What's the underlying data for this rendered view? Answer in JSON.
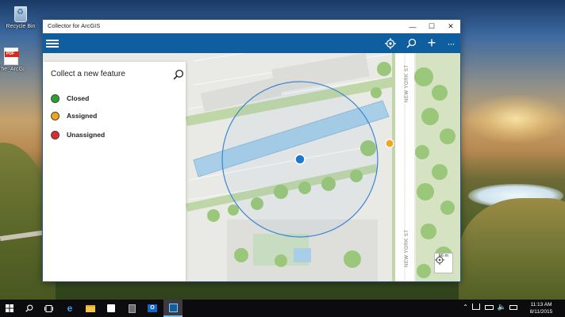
{
  "desktop": {
    "icons": [
      {
        "label": "Recycle Bin"
      },
      {
        "label": "The_ArcGI"
      }
    ]
  },
  "window": {
    "title": "Collector for ArcGIS",
    "controls": {
      "minimize": "—",
      "maximize": "☐",
      "close": "✕"
    }
  },
  "appbar": {
    "icons": [
      "hamburger-icon",
      "gps-locate-icon",
      "search-icon",
      "add-icon",
      "more-icon"
    ],
    "more_label": "···",
    "add_label": "+"
  },
  "panel": {
    "title": "Collect a new feature",
    "templates": [
      {
        "label": "Closed",
        "color": "#2ca02c"
      },
      {
        "label": "Assigned",
        "color": "#f2a51c"
      },
      {
        "label": "Unassigned",
        "color": "#e02b2b"
      }
    ]
  },
  "map": {
    "street_label": "NEW YORK ST",
    "scale_label": "56 m",
    "location_color": "#1e78d2",
    "accuracy_ring_color": "#3b86cf",
    "feature_color": "#f2a51c"
  },
  "taskbar": {
    "time": "11:13 AM",
    "date": "8/11/2015",
    "apps": [
      "start",
      "search",
      "task-view",
      "edge",
      "file-explorer",
      "store",
      "calculator",
      "outlook",
      "collector"
    ]
  },
  "colors": {
    "accent": "#0f5fa0"
  }
}
